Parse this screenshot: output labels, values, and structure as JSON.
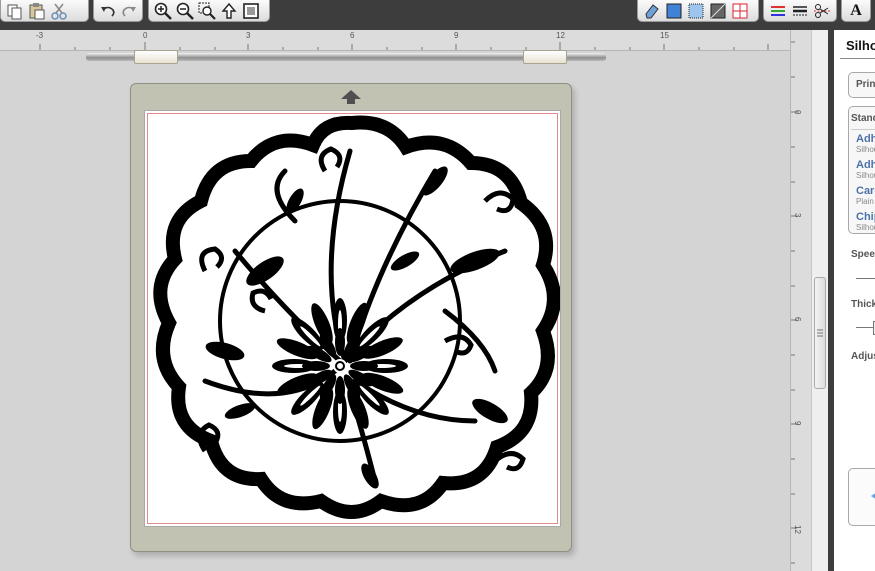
{
  "toolbar": {
    "groups": [
      {
        "name": "clipboard",
        "icons": [
          "copy-icon",
          "paste-icon",
          "cut-icon"
        ]
      },
      {
        "name": "history",
        "icons": [
          "undo-icon",
          "redo-icon"
        ]
      },
      {
        "name": "zoom",
        "icons": [
          "zoom-in-icon",
          "zoom-out-icon",
          "zoom-select-icon",
          "pan-icon",
          "fit-page-icon"
        ]
      },
      {
        "name": "view",
        "icons": [
          "eraser-icon",
          "fill-panel-icon",
          "pattern-panel-icon",
          "line-style-icon",
          "grid-panel-icon"
        ]
      },
      {
        "name": "styles",
        "icons": [
          "line-color-icon",
          "line-style-list-icon",
          "cut-style-icon"
        ]
      },
      {
        "name": "text",
        "icons": [
          "text-tool-icon"
        ]
      }
    ],
    "text_tool_label": "A",
    "colors": {
      "bar": "#3d3d3d"
    }
  },
  "ruler": {
    "h_labels": [
      "-3",
      "0",
      "3",
      "6",
      "9",
      "12",
      "15"
    ],
    "v_labels": [
      "0",
      "3",
      "6",
      "9",
      "12"
    ]
  },
  "mat": {
    "colors": {
      "mat": "#c1c2b1",
      "cut_border": "#e18b8b"
    }
  },
  "design": {
    "name": "chrysanthemum-medallion"
  },
  "panel": {
    "title": "Silhouette",
    "print_label": "Print",
    "section_label": "Standard",
    "materials": [
      {
        "name": "Adhesive",
        "sub": "Silhouette"
      },
      {
        "name": "Adhesive",
        "sub": "Silhouette"
      },
      {
        "name": "Cardstock",
        "sub": "Plain"
      },
      {
        "name": "Chipboard",
        "sub": "Silhouette"
      }
    ],
    "speed_label": "Speed",
    "thickness_label": "Thickness",
    "adjust_label": "Adjust"
  }
}
